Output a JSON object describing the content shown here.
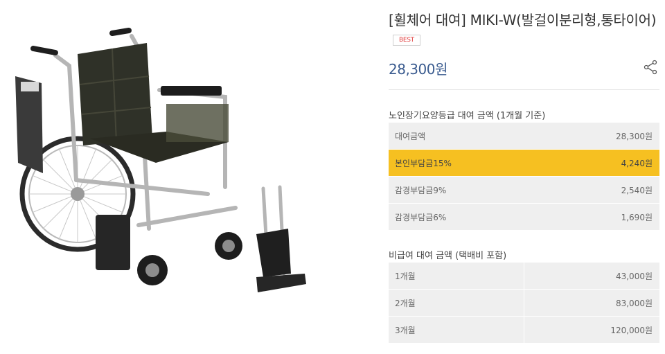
{
  "product": {
    "title": "[휠체어 대여] MIKI-W(발걸이분리형,통타이어)",
    "badge": "BEST",
    "price": "28,300원",
    "share_icon": "share-icon"
  },
  "ltc_section": {
    "title": "노인장기요양등급 대여 금액 (1개월 기준)",
    "rows": [
      {
        "label": "대여금액",
        "value": "28,300원",
        "highlight": false
      },
      {
        "label": "본인부담금15%",
        "value": "4,240원",
        "highlight": true
      },
      {
        "label": "감경부담금9%",
        "value": "2,540원",
        "highlight": false
      },
      {
        "label": "감경부담금6%",
        "value": "1,690원",
        "highlight": false
      }
    ]
  },
  "non_covered_section": {
    "title": "비급여 대여 금액 (택배비 포함)",
    "rows": [
      {
        "label": "1개월",
        "value": "43,000원"
      },
      {
        "label": "2개월",
        "value": "83,000원"
      },
      {
        "label": "3개월",
        "value": "120,000원"
      }
    ]
  },
  "colors": {
    "price": "#3a5b8f",
    "highlight": "#f6c021",
    "badge_text": "#e03a3a",
    "row_bg": "#efefef"
  }
}
